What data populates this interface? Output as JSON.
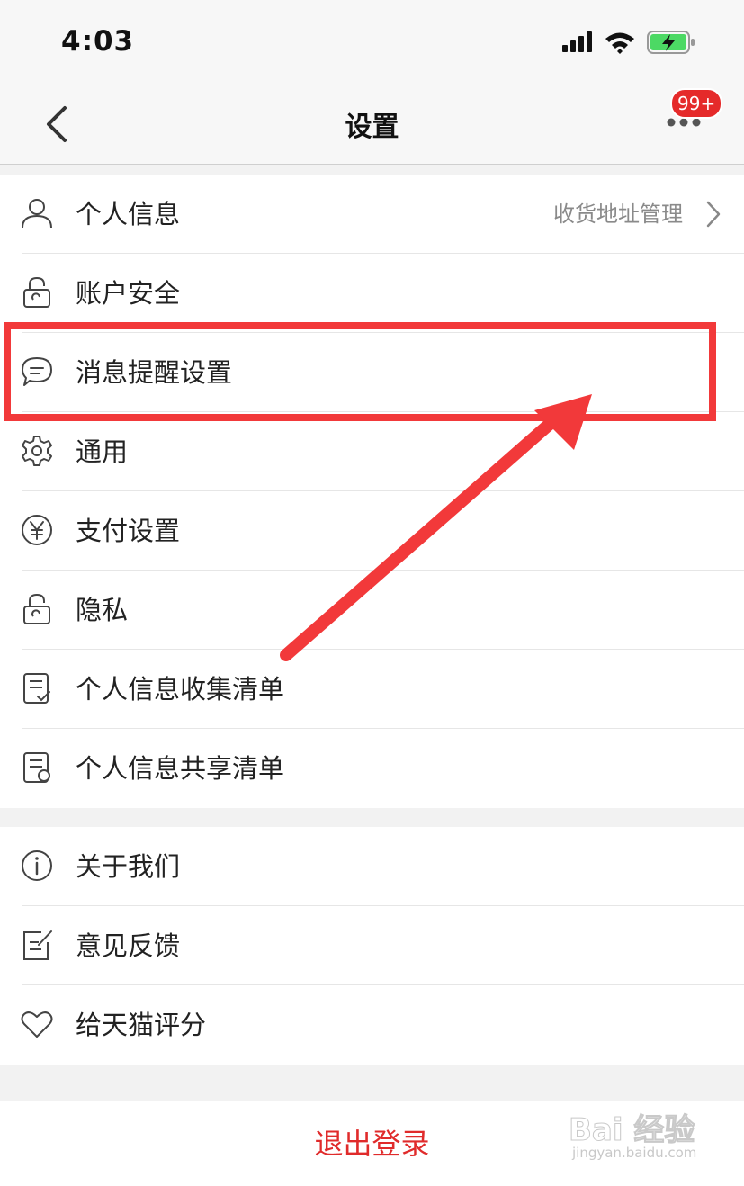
{
  "status_bar": {
    "time": "4:03"
  },
  "nav": {
    "title": "设置",
    "badge": "99+"
  },
  "section1": [
    {
      "label": "个人信息",
      "detail": "收货地址管理",
      "icon": "user-icon"
    },
    {
      "label": "账户安全",
      "icon": "lock-icon"
    },
    {
      "label": "消息提醒设置",
      "icon": "chat-bubble-icon"
    },
    {
      "label": "通用",
      "icon": "gear-icon"
    },
    {
      "label": "支付设置",
      "icon": "yen-icon"
    },
    {
      "label": "隐私",
      "icon": "lock-icon"
    },
    {
      "label": "个人信息收集清单",
      "icon": "checklist-icon"
    },
    {
      "label": "个人信息共享清单",
      "icon": "document-icon"
    }
  ],
  "section2": [
    {
      "label": "关于我们",
      "icon": "info-icon"
    },
    {
      "label": "意见反馈",
      "icon": "edit-icon"
    },
    {
      "label": "给天猫评分",
      "icon": "heart-icon"
    }
  ],
  "logout": {
    "label": "退出登录"
  },
  "watermark": {
    "text": "Bai 经验",
    "sub": "jingyan.baidu.com"
  },
  "colors": {
    "accent": "#e02b2b",
    "annotation": "#f2393a"
  }
}
